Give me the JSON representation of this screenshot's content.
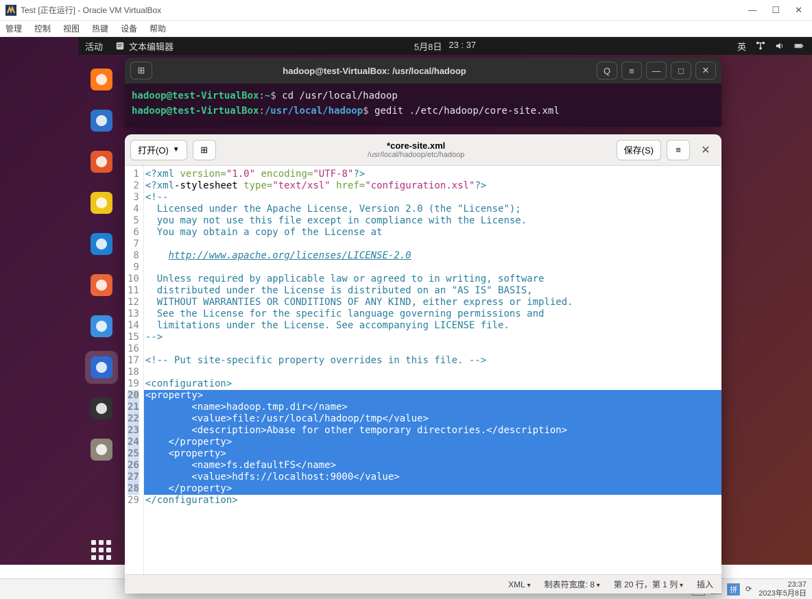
{
  "vbox": {
    "title": "Test [正在运行] - Oracle VM VirtualBox",
    "menus": [
      "管理",
      "控制",
      "视图",
      "热键",
      "设备",
      "帮助"
    ],
    "win_min": "—",
    "win_max": "☐",
    "win_close": "✕"
  },
  "ubuntu_topbar": {
    "activities": "活动",
    "app_label": "文本编辑器",
    "date": "5月8日",
    "time": "23 : 37",
    "ime": "英"
  },
  "dock": [
    {
      "name": "firefox-icon",
      "color": "#ff7a1a"
    },
    {
      "name": "thunderbird-icon",
      "color": "#2e73c8"
    },
    {
      "name": "files-icon",
      "color": "#e3572b"
    },
    {
      "name": "rhythmbox-icon",
      "color": "#f0c419"
    },
    {
      "name": "libreoffice-writer-icon",
      "color": "#1e81d6"
    },
    {
      "name": "software-icon",
      "color": "#eb6536"
    },
    {
      "name": "help-icon",
      "color": "#3a8fe0"
    },
    {
      "name": "text-editor-icon",
      "color": "#2c6bd0",
      "running": true
    },
    {
      "name": "terminal-icon",
      "color": "#333"
    },
    {
      "name": "trash-icon",
      "color": "#8f8679"
    }
  ],
  "terminal": {
    "header_title": "hadoop@test-VirtualBox: /usr/local/hadoop",
    "newtab": "⊞",
    "search": "Q",
    "menu": "≡",
    "min": "—",
    "max": "□",
    "close": "✕",
    "lines": [
      {
        "user": "hadoop@test-VirtualBox",
        "path": "~",
        "cmd": "cd /usr/local/hadoop"
      },
      {
        "user": "hadoop@test-VirtualBox",
        "path": "/usr/local/hadoop",
        "cmd": "gedit ./etc/hadoop/core-site.xml"
      }
    ]
  },
  "gedit": {
    "open_label": "打开(O)",
    "save_label": "保存(S)",
    "hamburger": "≡",
    "close": "✕",
    "newtab": "⊞",
    "title": "*core-site.xml",
    "subtitle": "/usr/local/hadoop/etc/hadoop",
    "status": {
      "lang": "XML",
      "tabwidth": "制表符宽度: 8",
      "cursor": "第 20 行，第 1 列",
      "mode": "插入"
    },
    "code_lines": [
      {
        "n": 1,
        "sel": false,
        "html": "<span class='tag'>&lt;?xml</span> <span class='attr'>version=</span><span class='str'>\"1.0\"</span> <span class='attr'>encoding=</span><span class='str'>\"UTF-8\"</span><span class='tag'>?&gt;</span>"
      },
      {
        "n": 2,
        "sel": false,
        "html": "<span class='tag'>&lt;?xml</span>-stylesheet <span class='attr'>type=</span><span class='str'>\"text/xsl\"</span> <span class='attr'>href=</span><span class='str'>\"configuration.xsl\"</span><span class='tag'>?&gt;</span>"
      },
      {
        "n": 3,
        "sel": false,
        "html": "<span class='cm'>&lt;!--</span>"
      },
      {
        "n": 4,
        "sel": false,
        "html": "<span class='cm'>  Licensed under the Apache License, Version 2.0 (the \"License\");</span>"
      },
      {
        "n": 5,
        "sel": false,
        "html": "<span class='cm'>  you may not use this file except in compliance with the License.</span>"
      },
      {
        "n": 6,
        "sel": false,
        "html": "<span class='cm'>  You may obtain a copy of the License at</span>"
      },
      {
        "n": 7,
        "sel": false,
        "html": ""
      },
      {
        "n": 8,
        "sel": false,
        "html": "    <span class='link'>http://www.apache.org/licenses/LICENSE-2.0</span>"
      },
      {
        "n": 9,
        "sel": false,
        "html": ""
      },
      {
        "n": 10,
        "sel": false,
        "html": "<span class='cm'>  Unless required by applicable law or agreed to in writing, software</span>"
      },
      {
        "n": 11,
        "sel": false,
        "html": "<span class='cm'>  distributed under the License is distributed on an \"AS IS\" BASIS,</span>"
      },
      {
        "n": 12,
        "sel": false,
        "html": "<span class='cm'>  WITHOUT WARRANTIES OR CONDITIONS OF ANY KIND, either express or implied.</span>"
      },
      {
        "n": 13,
        "sel": false,
        "html": "<span class='cm'>  See the License for the specific language governing permissions and</span>"
      },
      {
        "n": 14,
        "sel": false,
        "html": "<span class='cm'>  limitations under the License. See accompanying LICENSE file.</span>"
      },
      {
        "n": 15,
        "sel": false,
        "html": "<span class='cm'>--&gt;</span>"
      },
      {
        "n": 16,
        "sel": false,
        "html": ""
      },
      {
        "n": 17,
        "sel": false,
        "html": "<span class='cm'>&lt;!-- Put site-specific property overrides in this file. --&gt;</span>"
      },
      {
        "n": 18,
        "sel": false,
        "html": ""
      },
      {
        "n": 19,
        "sel": false,
        "html": "<span class='tag'>&lt;configuration&gt;</span>"
      },
      {
        "n": 20,
        "sel": true,
        "html": "&lt;property&gt;"
      },
      {
        "n": 21,
        "sel": true,
        "html": "        &lt;name&gt;hadoop.tmp.dir&lt;/name&gt;"
      },
      {
        "n": 22,
        "sel": true,
        "html": "        &lt;value&gt;file:/usr/local/hadoop/tmp&lt;/value&gt;"
      },
      {
        "n": 23,
        "sel": true,
        "html": "        &lt;description&gt;Abase for other temporary directories.&lt;/description&gt;"
      },
      {
        "n": 24,
        "sel": true,
        "html": "    &lt;/property&gt;"
      },
      {
        "n": 25,
        "sel": true,
        "html": "    &lt;property&gt;"
      },
      {
        "n": 26,
        "sel": true,
        "html": "        &lt;name&gt;fs.defaultFS&lt;/name&gt;"
      },
      {
        "n": 27,
        "sel": true,
        "html": "        &lt;value&gt;hdfs://localhost:9000&lt;/value&gt;"
      },
      {
        "n": 28,
        "sel": true,
        "html": "    &lt;/property&gt;"
      },
      {
        "n": 29,
        "sel": false,
        "html": "<span class='tag'>&lt;/configuration&gt;</span>"
      }
    ]
  },
  "host_taskbar": {
    "ime1": "英",
    "ime_mode": "♂",
    "ime2": "拼",
    "clock_time": "23:37",
    "clock_date": "2023年5月8日"
  }
}
